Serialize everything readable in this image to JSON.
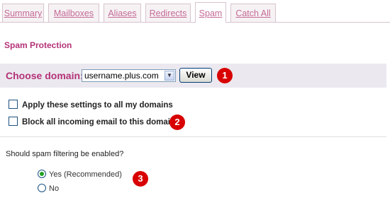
{
  "tabs": [
    {
      "label": "Summary",
      "active": false
    },
    {
      "label": "Mailboxes",
      "active": false
    },
    {
      "label": "Aliases",
      "active": false
    },
    {
      "label": "Redirects",
      "active": false
    },
    {
      "label": "Spam",
      "active": true
    },
    {
      "label": "Catch All",
      "active": false
    }
  ],
  "section_title": "Spam Protection",
  "domain": {
    "label": "Choose domain:",
    "selected": "username.plus.com",
    "view_button": "View"
  },
  "options": {
    "apply_all": "Apply these settings to all my domains",
    "block_all": "Block all incoming email to this domain"
  },
  "spam_filter": {
    "question": "Should spam filtering be enabled?",
    "choices": [
      {
        "label": "Yes (Recommended)",
        "checked": true
      },
      {
        "label": "No",
        "checked": false
      }
    ]
  },
  "callouts": [
    "1",
    "2",
    "3"
  ],
  "colors": {
    "accent": "#b43278",
    "tab_link": "#c46a96",
    "badge": "#d80000"
  }
}
